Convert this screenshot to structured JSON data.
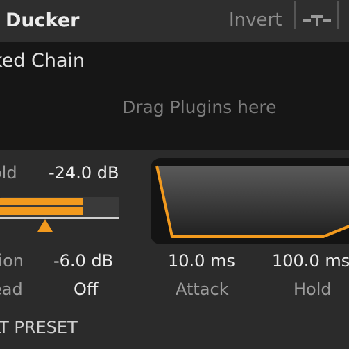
{
  "header": {
    "title": "Ducker",
    "invert_label": "Invert",
    "route_icon": "routing-icon"
  },
  "chain": {
    "title": "ked Chain",
    "placeholder": "Drag Plugins here"
  },
  "threshold": {
    "label": "old",
    "value": "-24.0 dB",
    "meter_levels": [
      0.7,
      0.7
    ],
    "marker_level": 0.38
  },
  "reduction": {
    "label": "tion",
    "value": "-6.0 dB"
  },
  "lookahead": {
    "label": "ead",
    "value": "Off"
  },
  "attack": {
    "label": "Attack",
    "value": "10.0 ms"
  },
  "hold": {
    "label": "Hold",
    "value": "100.0 ms"
  },
  "preset": {
    "label": "LT PRESET"
  },
  "colors": {
    "accent": "#f29a1e",
    "panel_dark": "#161616",
    "background": "#2b2b2b"
  }
}
